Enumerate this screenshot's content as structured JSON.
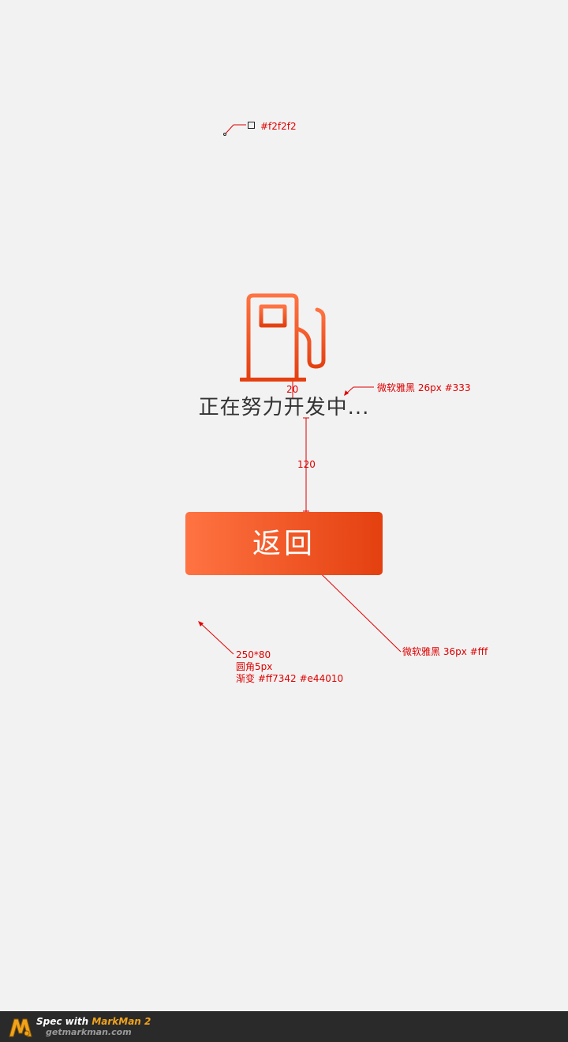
{
  "status": {
    "message": "正在努力开发中..."
  },
  "button": {
    "back_label": "返回"
  },
  "annotations": {
    "bg_color": "#f2f2f2",
    "spacing_icon_text": "20",
    "spacing_text_button": "120",
    "text_font_spec": "微软雅黑 26px  #333",
    "button_font_spec": "微软雅黑 36px  #fff",
    "button_size": "250*80",
    "button_radius": "圆角5px",
    "button_gradient": "渐变 #ff7342 #e44010"
  },
  "footer": {
    "spec_with": "Spec with ",
    "brand": "MarkMan 2",
    "site": "getmarkman.com"
  },
  "colors": {
    "background": "#f2f2f2",
    "text": "#333333",
    "gradient_start": "#ff7342",
    "gradient_end": "#e44010",
    "annotation": "#e00000"
  },
  "icons": {
    "main": "fuel-pump-icon",
    "footer": "markman-logo-icon"
  }
}
